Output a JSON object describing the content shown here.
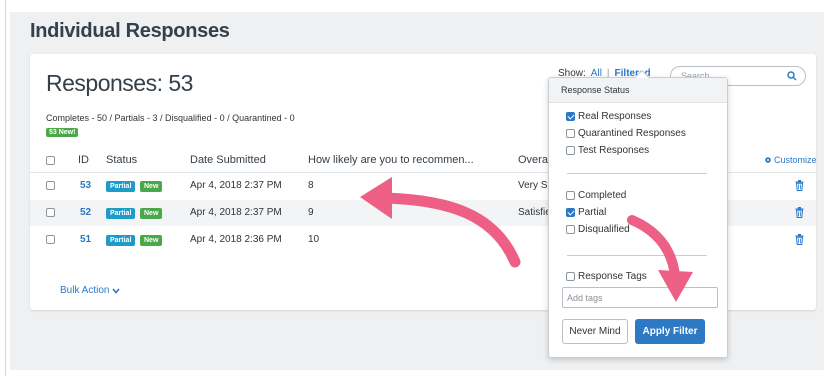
{
  "page": {
    "title": "Individual Responses"
  },
  "card": {
    "responses_title": "Responses: 53",
    "summary": "Completes - 50 / Partials - 3 / Disqualified - 0 / Quarantined - 0",
    "new_badge": "53 New!",
    "show_label": "Show:",
    "show_all": "All",
    "show_sep": "|",
    "show_filtered": "Filtered",
    "search_placeholder": "Search",
    "customize_label": "Customize",
    "bulk_action_label": "Bulk Action"
  },
  "table": {
    "columns": [
      "ID",
      "Status",
      "Date Submitted",
      "How likely are you to recommen...",
      "Overall F"
    ],
    "rows": [
      {
        "id": "53",
        "status": "Partial",
        "badge": "New",
        "date": "Apr 4, 2018 2:37 PM",
        "score": "8",
        "overall": "Very Satis"
      },
      {
        "id": "52",
        "status": "Partial",
        "badge": "New",
        "date": "Apr 4, 2018 2:37 PM",
        "score": "9",
        "overall": "Satisfied"
      },
      {
        "id": "51",
        "status": "Partial",
        "badge": "New",
        "date": "Apr 4, 2018 2:36 PM",
        "score": "10",
        "overall": ""
      }
    ]
  },
  "filter": {
    "header": "Response Status",
    "status_options": [
      {
        "label": "Real Responses",
        "checked": true
      },
      {
        "label": "Quarantined Responses",
        "checked": false
      },
      {
        "label": "Test Responses",
        "checked": false
      }
    ],
    "completion_options": [
      {
        "label": "Completed",
        "checked": false
      },
      {
        "label": "Partial",
        "checked": true
      },
      {
        "label": "Disqualified",
        "checked": false
      }
    ],
    "tags_label": "Response Tags",
    "tags_placeholder": "Add tags",
    "never_mind_label": "Never Mind",
    "apply_label": "Apply Filter"
  },
  "colors": {
    "accent": "#2a77c9",
    "partial_badge": "#1d9bc9",
    "new_badge": "#4aa84a",
    "arrow": "#ee5f86"
  },
  "icons": {
    "search": "search-icon",
    "trash": "trash-icon",
    "gear": "gear-icon",
    "chevron": "chevron-down-icon"
  }
}
